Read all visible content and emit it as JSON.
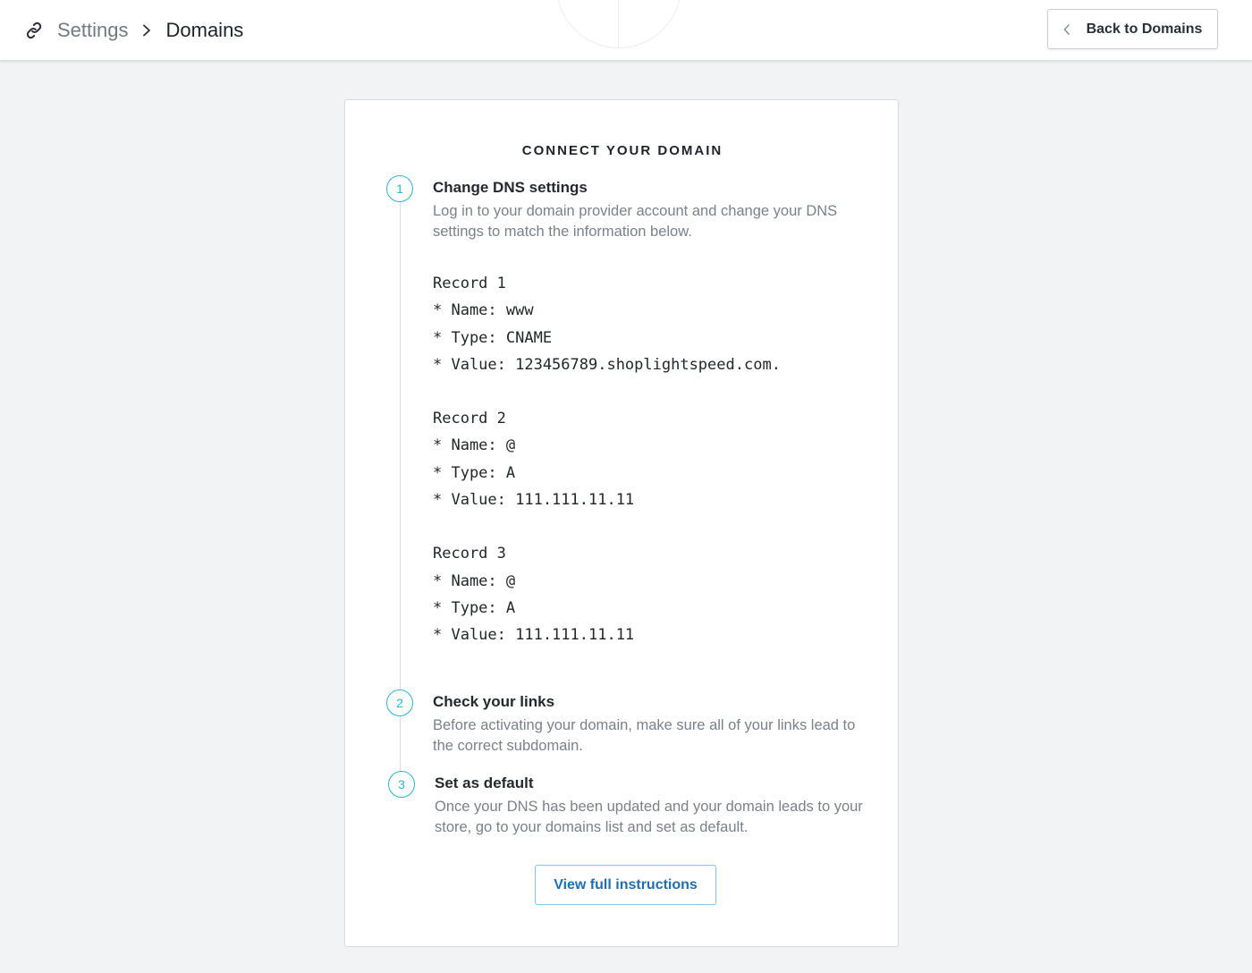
{
  "header": {
    "icon": "link-icon",
    "breadcrumb_parent": "Settings",
    "breadcrumb_separator_icon": "chevron-right-icon",
    "breadcrumb_current": "Domains",
    "back_button_label": "Back to Domains"
  },
  "card": {
    "title": "CONNECT YOUR DOMAIN",
    "steps": [
      {
        "number": "1",
        "title": "Change DNS settings",
        "description": "Log in to your domain provider account and change your DNS settings to match the information below."
      },
      {
        "number": "2",
        "title": "Check your links",
        "description": "Before activating your domain, make sure all of your links lead to the correct subdomain."
      },
      {
        "number": "3",
        "title": "Set as default",
        "description": "Once your DNS has been updated and your domain leads to your store, go to your domains list and set as default."
      }
    ],
    "records": [
      {
        "heading": "Record 1",
        "name": "* Name: www",
        "type": "* Type: CNAME",
        "value": "* Value: 123456789.shoplightspeed.com."
      },
      {
        "heading": "Record 2",
        "name": "* Name: @",
        "type": "* Type: A",
        "value": "* Value: 111.111.11.11"
      },
      {
        "heading": "Record 3",
        "name": "* Name: @",
        "type": "* Type: A",
        "value": "* Value: 111.111.11.11"
      }
    ],
    "view_instructions_label": "View full instructions"
  },
  "colors": {
    "accent": "#2bb5d8",
    "link": "#1e6fb0",
    "background": "#f1f3f5"
  }
}
